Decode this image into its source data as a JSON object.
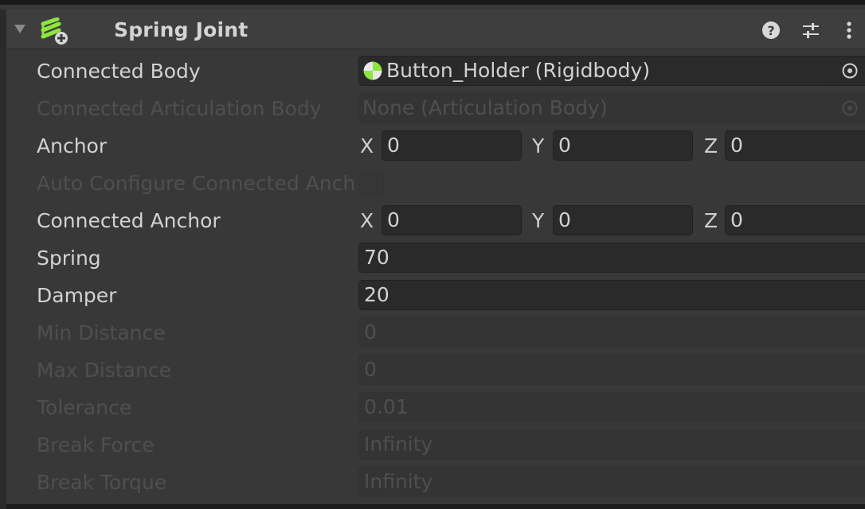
{
  "component": {
    "title": "Spring Joint",
    "icon": "spring-joint-icon",
    "help_icon": "help-icon",
    "presets_icon": "presets-icon",
    "menu_icon": "kebab-menu-icon"
  },
  "fields": {
    "connected_body": {
      "label": "Connected Body",
      "value": "Button_Holder (Rigidbody)",
      "icon": "rigidbody-icon",
      "picker_icon": "object-picker-icon"
    },
    "connected_articulation_body": {
      "label": "Connected Articulation Body",
      "value": "None (Articulation Body)",
      "picker_icon": "object-picker-icon"
    },
    "anchor": {
      "label": "Anchor",
      "x_label": "X",
      "x": "0",
      "y_label": "Y",
      "y": "0",
      "z_label": "Z",
      "z": "0"
    },
    "auto_configure": {
      "label": "Auto Configure Connected Anchor",
      "checked": false
    },
    "connected_anchor": {
      "label": "Connected Anchor",
      "x_label": "X",
      "x": "0",
      "y_label": "Y",
      "y": "0",
      "z_label": "Z",
      "z": "0"
    },
    "spring": {
      "label": "Spring",
      "value": "70"
    },
    "damper": {
      "label": "Damper",
      "value": "20"
    },
    "min_distance": {
      "label": "Min Distance",
      "value": "0"
    },
    "max_distance": {
      "label": "Max Distance",
      "value": "0"
    },
    "tolerance": {
      "label": "Tolerance",
      "value": "0.01"
    },
    "break_force": {
      "label": "Break Force",
      "value": "Infinity"
    },
    "break_torque": {
      "label": "Break Torque",
      "value": "Infinity"
    }
  },
  "colors": {
    "background": "#383838",
    "header": "#3e3e3e",
    "field": "#2a2a2a",
    "text": "#d2d2d2",
    "disabled_text": "#4f4f4f",
    "icon_green": "#8ee53f"
  }
}
